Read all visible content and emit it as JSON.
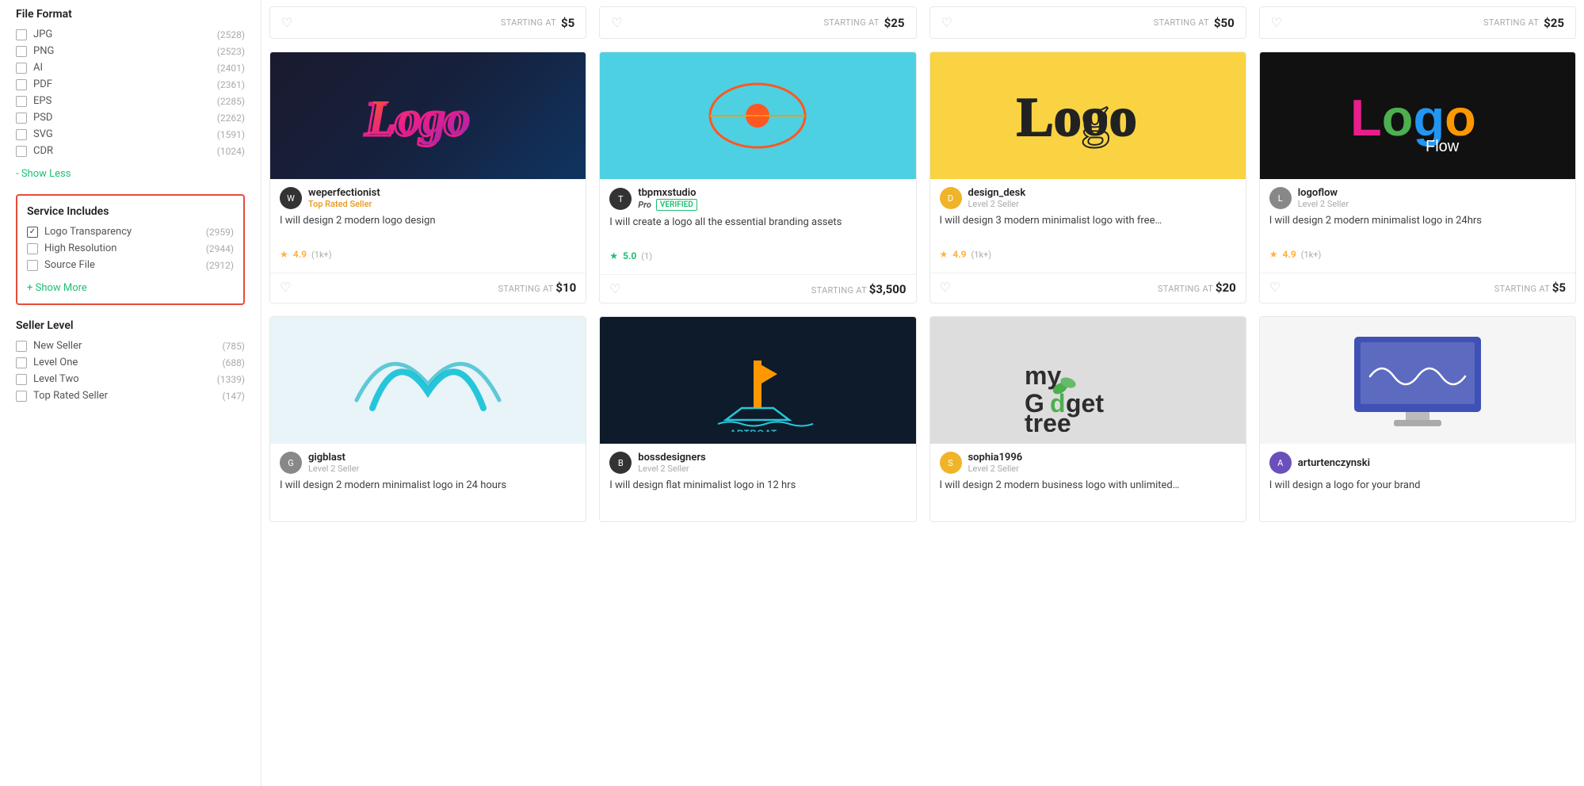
{
  "sidebar": {
    "file_format": {
      "title": "File Format",
      "items": [
        {
          "label": "JPG",
          "count": "(2528)",
          "checked": false
        },
        {
          "label": "PNG",
          "count": "(2523)",
          "checked": false
        },
        {
          "label": "AI",
          "count": "(2401)",
          "checked": false
        },
        {
          "label": "PDF",
          "count": "(2361)",
          "checked": false
        },
        {
          "label": "EPS",
          "count": "(2285)",
          "checked": false
        },
        {
          "label": "PSD",
          "count": "(2262)",
          "checked": false
        },
        {
          "label": "SVG",
          "count": "(1591)",
          "checked": false
        },
        {
          "label": "CDR",
          "count": "(1024)",
          "checked": false
        }
      ],
      "show_less_label": "- Show Less"
    },
    "service_includes": {
      "title": "Service Includes",
      "items": [
        {
          "label": "Logo Transparency",
          "count": "(2959)",
          "checked": true
        },
        {
          "label": "High Resolution",
          "count": "(2944)",
          "checked": false
        },
        {
          "label": "Source File",
          "count": "(2912)",
          "checked": false
        }
      ],
      "show_more_label": "+ Show More"
    },
    "seller_level": {
      "title": "Seller Level",
      "items": [
        {
          "label": "New Seller",
          "count": "(785)",
          "checked": false
        },
        {
          "label": "Level One",
          "count": "(688)",
          "checked": false
        },
        {
          "label": "Level Two",
          "count": "(1339)",
          "checked": false
        },
        {
          "label": "Top Rated Seller",
          "count": "(147)",
          "checked": false
        }
      ]
    }
  },
  "top_row": [
    {
      "id": "tr1",
      "starting_at": "STARTING AT",
      "price": "$5"
    },
    {
      "id": "tr2",
      "starting_at": "STARTING AT",
      "price": "$25"
    },
    {
      "id": "tr3",
      "starting_at": "STARTING AT",
      "price": "$50"
    },
    {
      "id": "tr4",
      "starting_at": "STARTING AT",
      "price": "$25"
    }
  ],
  "gigs": [
    {
      "id": "weperfectionist",
      "seller_name": "weperfectionist",
      "seller_level": "Top Rated Seller",
      "seller_level_type": "top_rated",
      "avatar_char": "W",
      "avatar_color": "dark",
      "title": "I will design 2 modern logo design",
      "rating": "4.9",
      "rating_color": "yellow",
      "review_count": "(1k+)",
      "starting_at": "STARTING AT",
      "price": "$10",
      "image_type": "weperfectionist"
    },
    {
      "id": "tbpmxstudio",
      "seller_name": "tbpmxstudio",
      "seller_level": "",
      "seller_level_type": "pro_verified",
      "avatar_char": "T",
      "avatar_color": "dark",
      "title": "I will create a logo all the essential branding assets",
      "rating": "5.0",
      "rating_color": "teal",
      "review_count": "(1)",
      "starting_at": "STARTING AT",
      "price": "$3,500",
      "image_type": "tbpmx"
    },
    {
      "id": "design_desk",
      "seller_name": "design_desk",
      "seller_level": "Level 2 Seller",
      "seller_level_type": "normal",
      "avatar_char": "D",
      "avatar_color": "yellow",
      "title": "I will design 3 modern minimalist logo with free…",
      "rating": "4.9",
      "rating_color": "yellow",
      "review_count": "(1k+)",
      "starting_at": "STARTING AT",
      "price": "$20",
      "image_type": "design_desk"
    },
    {
      "id": "logoflow",
      "seller_name": "logoflow",
      "seller_level": "Level 2 Seller",
      "seller_level_type": "normal",
      "avatar_char": "L",
      "avatar_color": "dark",
      "title": "I will design 2 modern minimalist logo in 24hrs",
      "rating": "4.9",
      "rating_color": "yellow",
      "review_count": "(1k+)",
      "starting_at": "STARTING AT",
      "price": "$5",
      "image_type": "logoflow"
    },
    {
      "id": "gigblast",
      "seller_name": "gigblast",
      "seller_level": "Level 2 Seller",
      "seller_level_type": "normal",
      "avatar_char": "G",
      "avatar_color": "teal",
      "title": "I will design 2 modern minimalist logo in 24 hours",
      "rating": "",
      "rating_color": "",
      "review_count": "",
      "starting_at": "",
      "price": "",
      "image_type": "gigblast"
    },
    {
      "id": "bossdesigners",
      "seller_name": "bossdesigners",
      "seller_level": "Level 2 Seller",
      "seller_level_type": "normal",
      "avatar_char": "B",
      "avatar_color": "dark",
      "title": "I will design flat minimalist logo in 12 hrs",
      "rating": "",
      "rating_color": "",
      "review_count": "",
      "starting_at": "",
      "price": "",
      "image_type": "bossdesigners"
    },
    {
      "id": "sophia1996",
      "seller_name": "sophia1996",
      "seller_level": "Level 2 Seller",
      "seller_level_type": "normal",
      "avatar_char": "S",
      "avatar_color": "yellow",
      "title": "I will design 2 modern business logo with unlimited…",
      "rating": "",
      "rating_color": "",
      "review_count": "",
      "starting_at": "",
      "price": "",
      "image_type": "sophia"
    },
    {
      "id": "arturtenczynski",
      "seller_name": "arturtenczynski",
      "seller_level": "",
      "seller_level_type": "normal",
      "avatar_char": "A",
      "avatar_color": "purple",
      "title": "I will design a logo for your brand",
      "rating": "",
      "rating_color": "",
      "review_count": "",
      "starting_at": "",
      "price": "",
      "image_type": "artur"
    }
  ],
  "labels": {
    "starting_at": "STARTING AT",
    "pro_verified": "Pro VERIFIED"
  }
}
